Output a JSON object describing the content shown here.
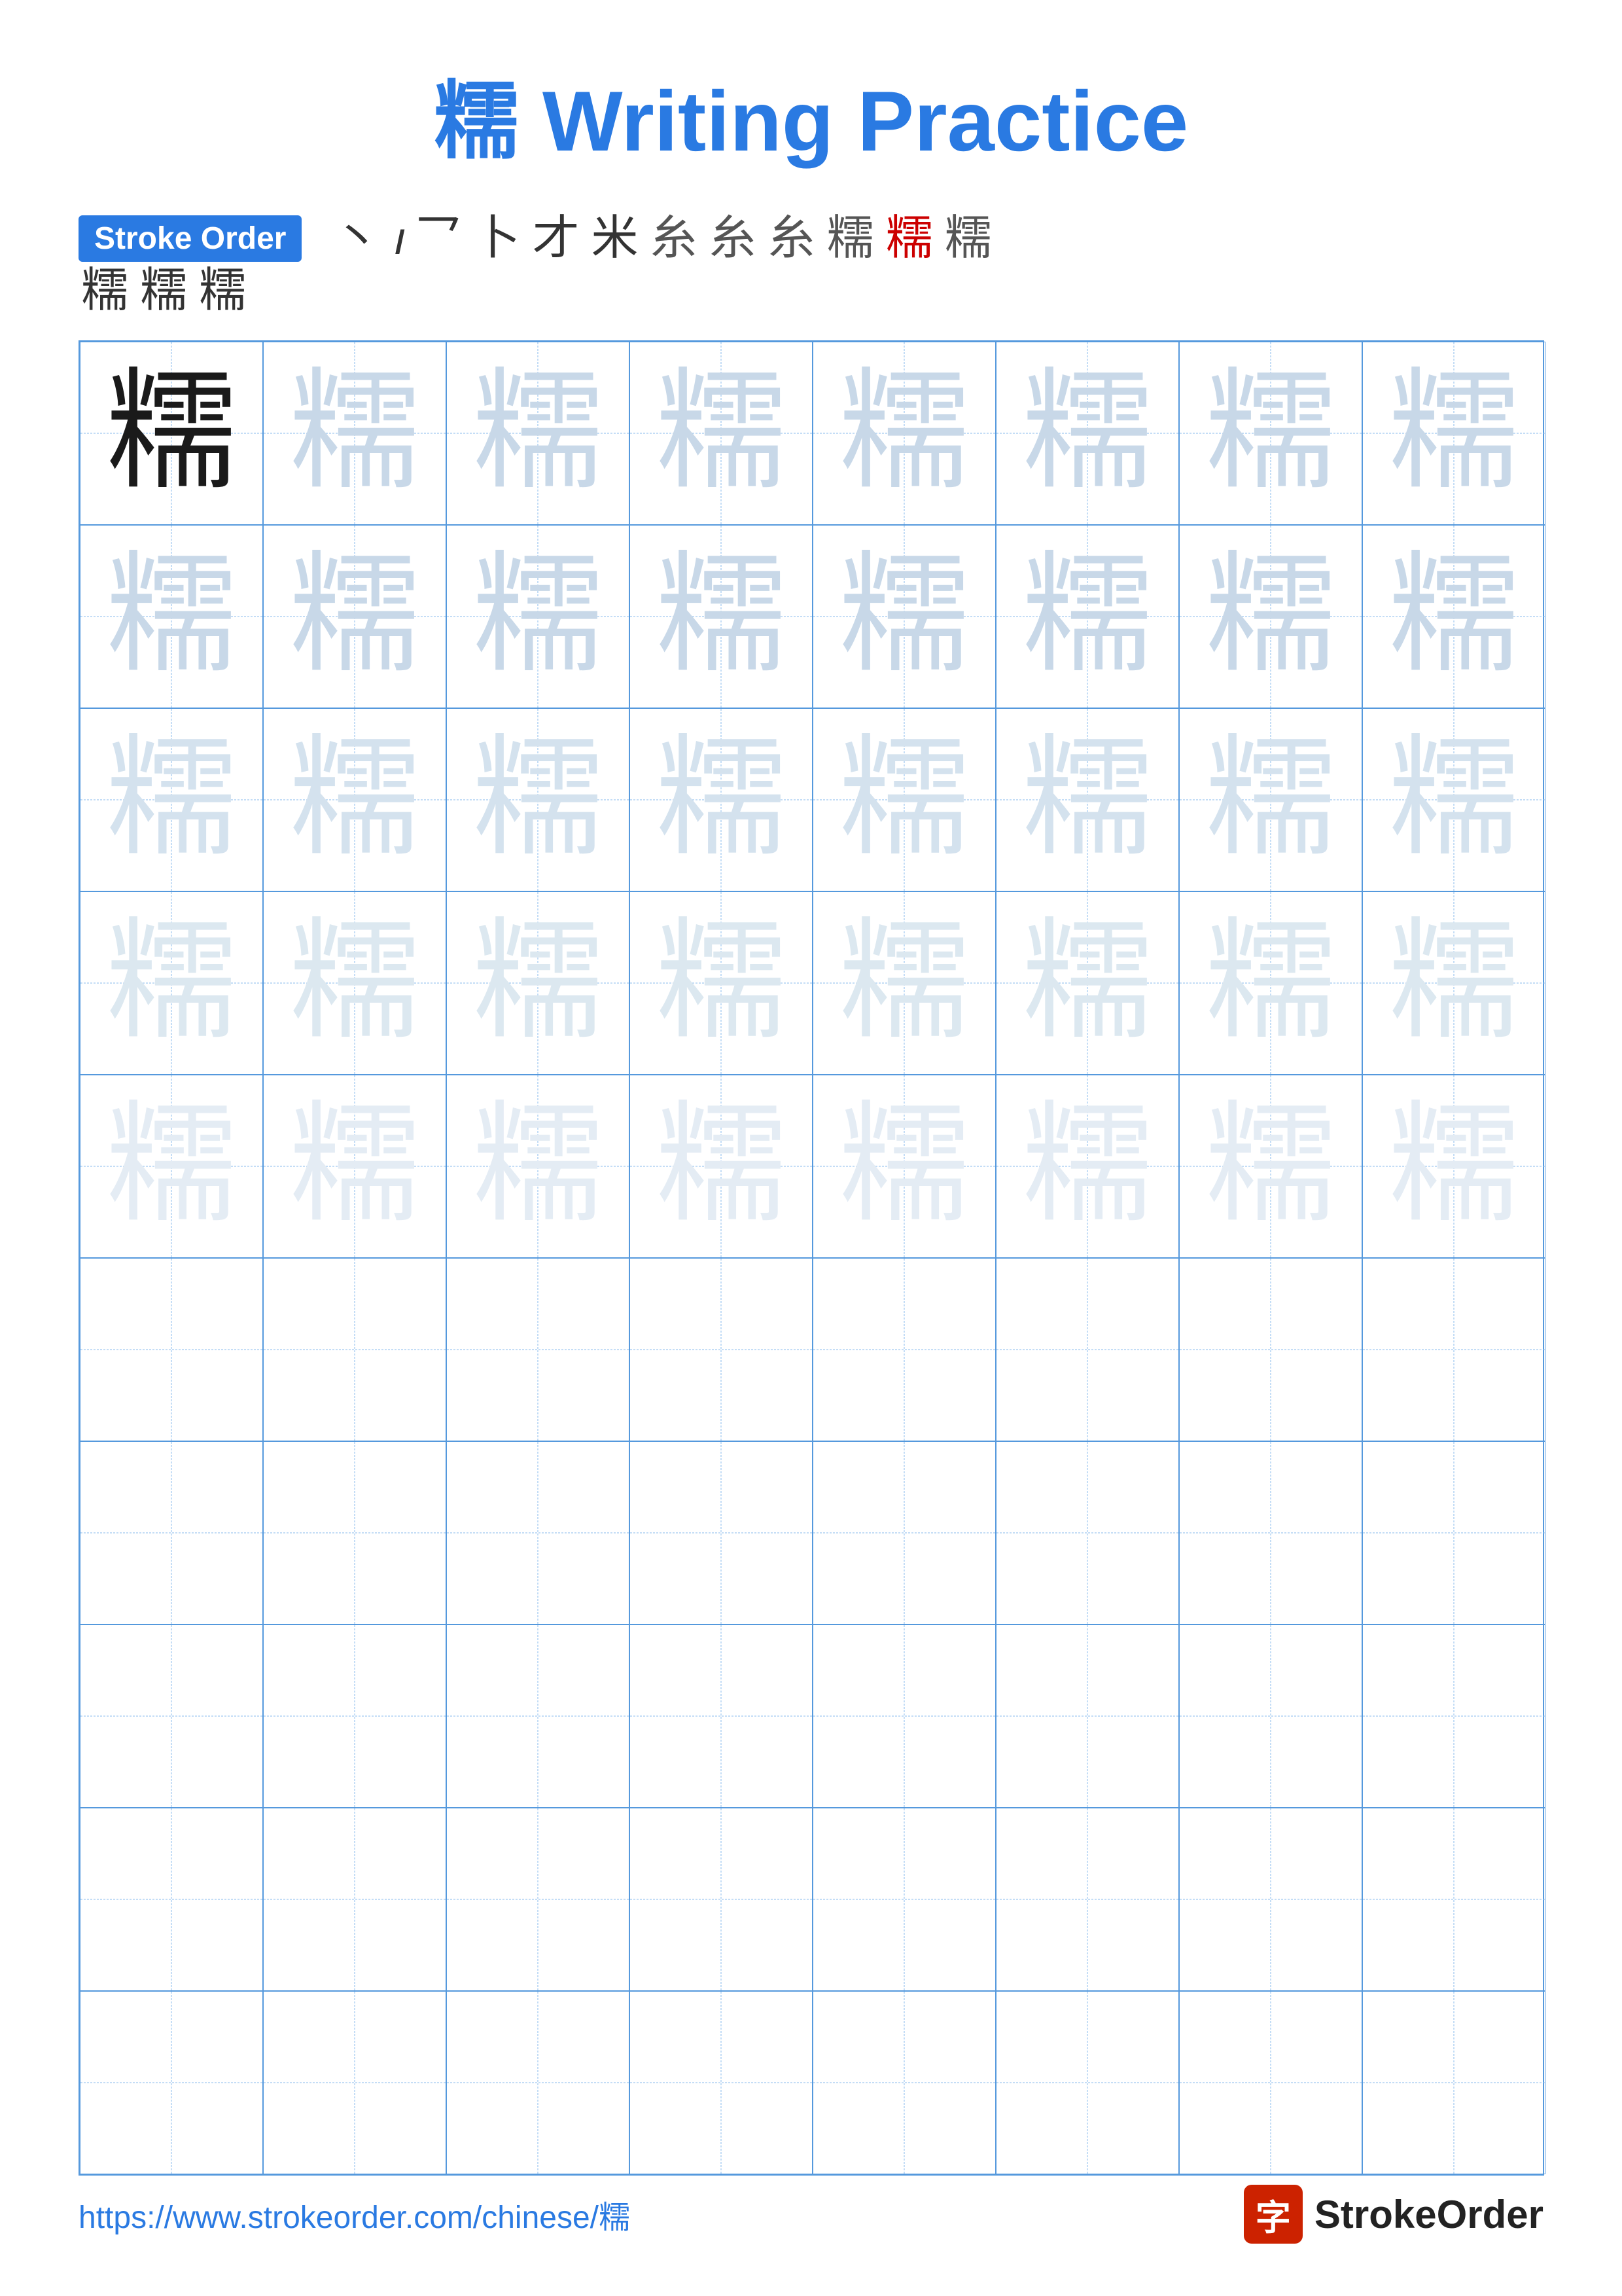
{
  "page": {
    "title": "糯 Writing Practice",
    "title_char": "糯",
    "title_text": " Writing Practice"
  },
  "stroke_order": {
    "badge_label": "Stroke Order",
    "steps_row1": [
      "丶",
      "𝚤",
      "乛",
      "卜",
      "才",
      "米",
      "米",
      "米⁻",
      "米⁷",
      "糯⁰",
      "糯¹",
      "糯²"
    ],
    "steps_display_row1": [
      "丶",
      "𝚤",
      "乛",
      "卜",
      "才",
      "米",
      "米",
      "米",
      "米",
      "糯",
      "糯",
      "糯"
    ],
    "steps_row2": [
      "糯",
      "糯",
      "糯"
    ]
  },
  "character": "糯",
  "grid": {
    "rows": 10,
    "cols": 8,
    "practice_rows_with_char": 5,
    "empty_rows": 5
  },
  "footer": {
    "url": "https://www.strokeorder.com/chinese/糯",
    "logo_char": "字",
    "logo_text": "StrokeOrder"
  }
}
